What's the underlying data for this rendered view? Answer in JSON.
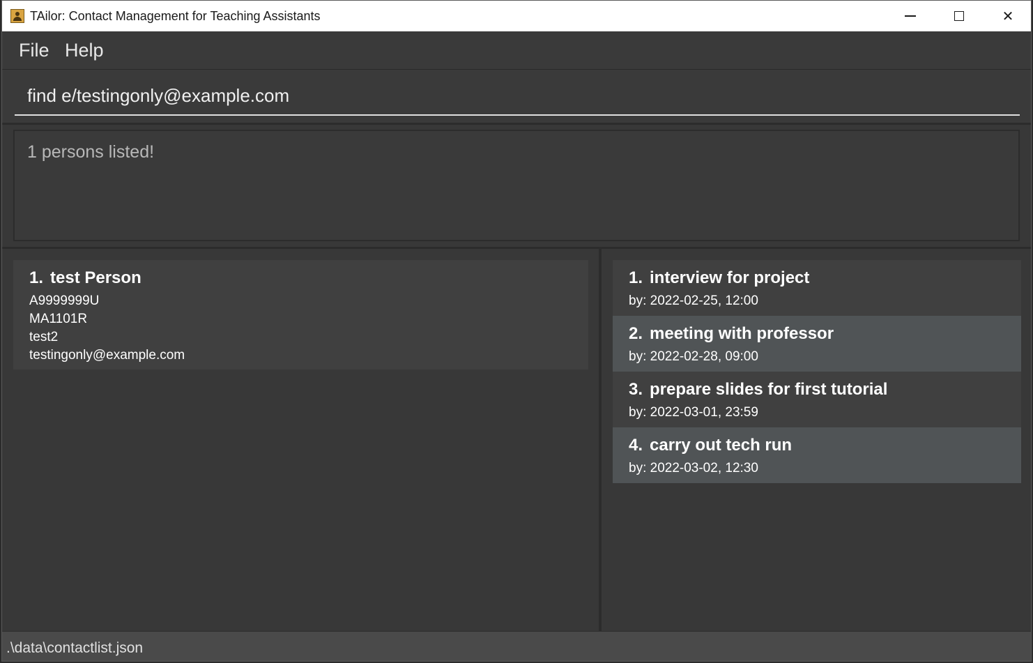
{
  "window": {
    "title": "TAilor: Contact Management for Teaching Assistants",
    "controls": {
      "minimize": "minimize",
      "maximize": "maximize",
      "close": "✕"
    }
  },
  "menu": {
    "items": [
      {
        "label": "File"
      },
      {
        "label": "Help"
      }
    ]
  },
  "command": {
    "value": "find e/testingonly@example.com"
  },
  "result": {
    "text": "1 persons listed!"
  },
  "persons": [
    {
      "index": "1.",
      "name": "test Person",
      "student_id": "A9999999U",
      "module": "MA1101R",
      "tag": "test2",
      "email": "testingonly@example.com"
    }
  ],
  "tasks": [
    {
      "index": "1.",
      "title": "interview for project",
      "deadline": "by: 2022-02-25, 12:00"
    },
    {
      "index": "2.",
      "title": "meeting with professor",
      "deadline": "by: 2022-02-28, 09:00"
    },
    {
      "index": "3.",
      "title": "prepare slides for first tutorial",
      "deadline": "by: 2022-03-01, 23:59"
    },
    {
      "index": "4.",
      "title": "carry out tech run",
      "deadline": "by: 2022-03-02, 12:30"
    }
  ],
  "status": {
    "path": ".\\data\\contactlist.json"
  }
}
